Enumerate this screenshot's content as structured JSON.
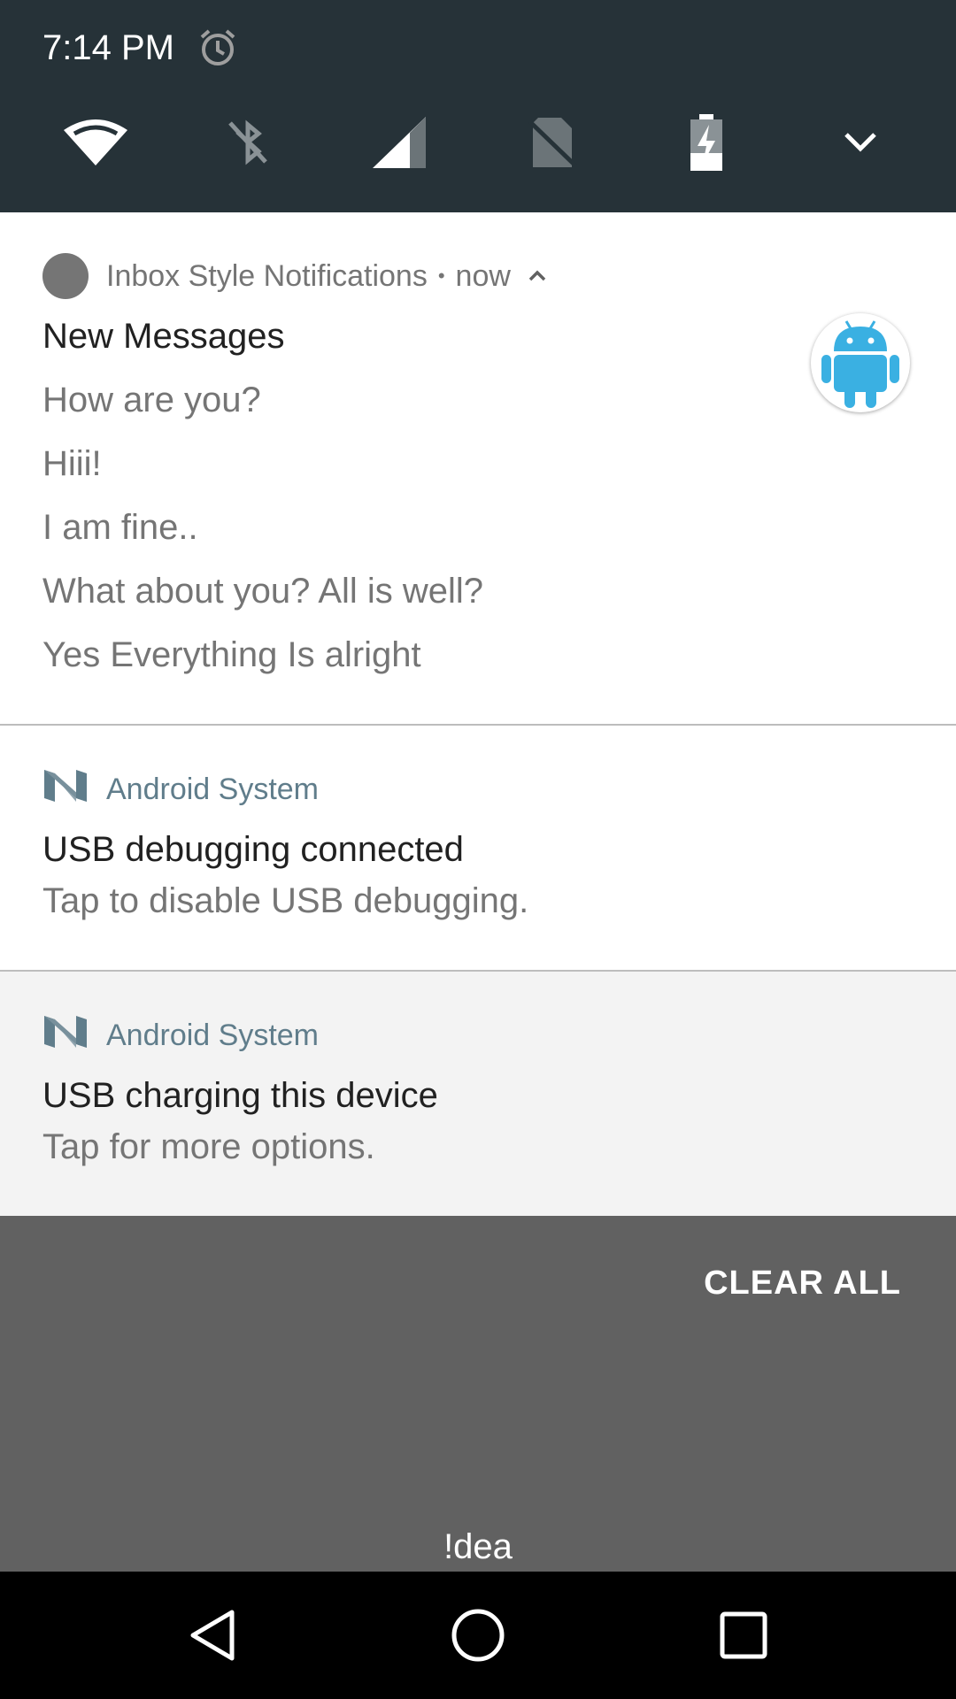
{
  "status_bar": {
    "time": "7:14 PM",
    "alarm_icon": "alarm-clock-icon"
  },
  "quick_settings": {
    "tiles": [
      "wifi-icon",
      "bluetooth-off-icon",
      "signal-icon",
      "no-sim-icon",
      "battery-charging-icon",
      "expand-chevron-icon"
    ]
  },
  "notifications": [
    {
      "app_name": "Inbox Style Notifications",
      "time": "now",
      "title": "New Messages",
      "lines": [
        "How are you?",
        "Hiii!",
        "I am fine..",
        "What about you? All is well?",
        "Yes Everything Is alright"
      ],
      "large_icon": "android-robot-icon"
    },
    {
      "app_name": "Android System",
      "title": "USB debugging connected",
      "text": "Tap to disable USB debugging."
    },
    {
      "app_name": "Android System",
      "title": "USB charging this device",
      "text": "Tap for more options."
    }
  ],
  "clear_all_label": "CLEAR ALL",
  "carrier_label": "!dea",
  "colors": {
    "header_bg": "#263238",
    "system_app_color": "#607d8b",
    "android_green": "#3ab0e2",
    "scrim": "#616161"
  }
}
